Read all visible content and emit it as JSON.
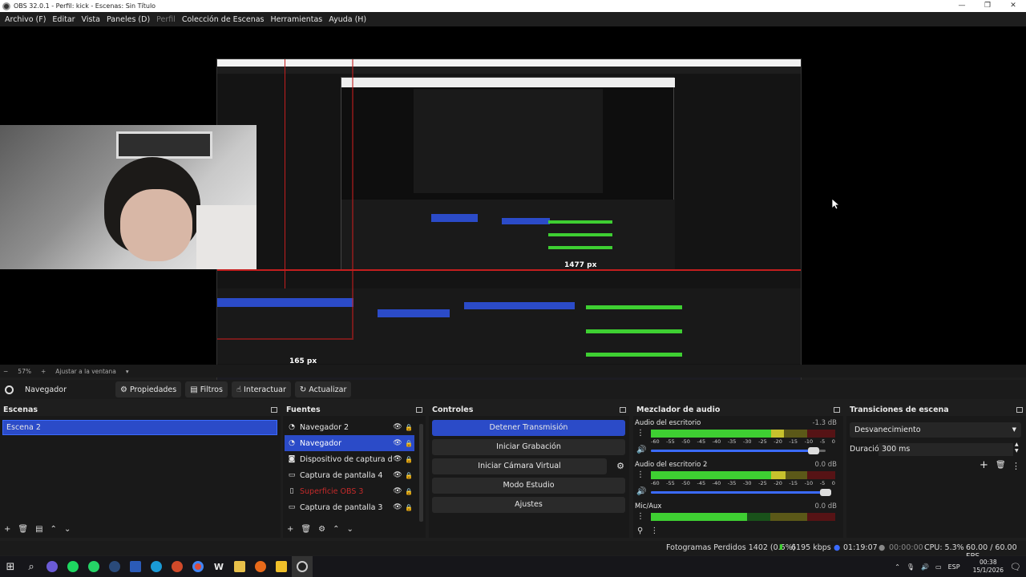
{
  "window": {
    "title": "OBS 32.0.1 - Perfil: kick - Escenas: Sin Título",
    "minimize": "—",
    "maximize": "❐",
    "close": "✕"
  },
  "menu": [
    "Archivo (F)",
    "Editar",
    "Vista",
    "Paneles (D)",
    "Perfil",
    "Colección de Escenas",
    "Herramientas",
    "Ayuda (H)"
  ],
  "zoom": {
    "minus": "−",
    "level": "57%",
    "plus": "+",
    "fit": "Ajustar a la ventana",
    "arrow": "▾"
  },
  "source_toolbar": {
    "name": "Navegador",
    "buttons": [
      "Propiedades",
      "Filtros",
      "Interactuar",
      "Actualizar"
    ]
  },
  "preview_labels": {
    "width_top": "1477 px",
    "width_bottom": "165 px",
    "inner_width": "1477 px"
  },
  "scenes": {
    "title": "Escenas",
    "items": [
      "Escena 2"
    ],
    "selected": 0
  },
  "sources": {
    "title": "Fuentes",
    "items": [
      {
        "name": "Navegador 2",
        "icon": "globe-icon",
        "color": "#e8e8e8"
      },
      {
        "name": "Navegador",
        "icon": "globe-icon",
        "color": "#ffffff"
      },
      {
        "name": "Dispositivo de captura de vídeo",
        "icon": "camera-icon",
        "color": "#e8e8e8"
      },
      {
        "name": "Captura de pantalla 4",
        "icon": "monitor-icon",
        "color": "#e8e8e8"
      },
      {
        "name": "Superficie OBS 3",
        "icon": "file-icon",
        "color": "#c52a2a"
      },
      {
        "name": "Captura de pantalla 3",
        "icon": "monitor-icon",
        "color": "#e8e8e8"
      }
    ],
    "selected": 1
  },
  "controls": {
    "title": "Controles",
    "buttons": [
      "Detener Transmisión",
      "Iniciar Grabación",
      "Iniciar Cámara Virtual",
      "Modo Estudio",
      "Ajustes"
    ]
  },
  "mixer": {
    "title": "Mezclador de audio",
    "ticks": [
      "-60",
      "-55",
      "-50",
      "-45",
      "-40",
      "-35",
      "-30",
      "-25",
      "-20",
      "-15",
      "-10",
      "-5",
      "0"
    ],
    "channels": [
      {
        "name": "Audio del escritorio",
        "db": "-1.3 dB",
        "level": 0.72,
        "volume": 0.93
      },
      {
        "name": "Audio del escritorio 2",
        "db": "0.0 dB",
        "level": 0.73,
        "volume": 1.0
      },
      {
        "name": "Mic/Aux",
        "db": "0.0 dB",
        "level": 0.52,
        "volume": 1.0
      }
    ]
  },
  "transitions": {
    "title": "Transiciones de escena",
    "selected": "Desvanecimiento",
    "duration_label": "Duración",
    "duration_value": "300 ms"
  },
  "status": {
    "dropped": "Fotogramas Perdidos 1402 (0.5%)",
    "bitrate": "6195 kbps",
    "stream_time": "01:19:07",
    "rec_time": "00:00:00",
    "cpu": "CPU: 5.3%",
    "fps": "60.00 / 60.00 FPS"
  },
  "taskbar": {
    "lang": "ESP",
    "time": "00:38",
    "date": "15/1/2026"
  }
}
